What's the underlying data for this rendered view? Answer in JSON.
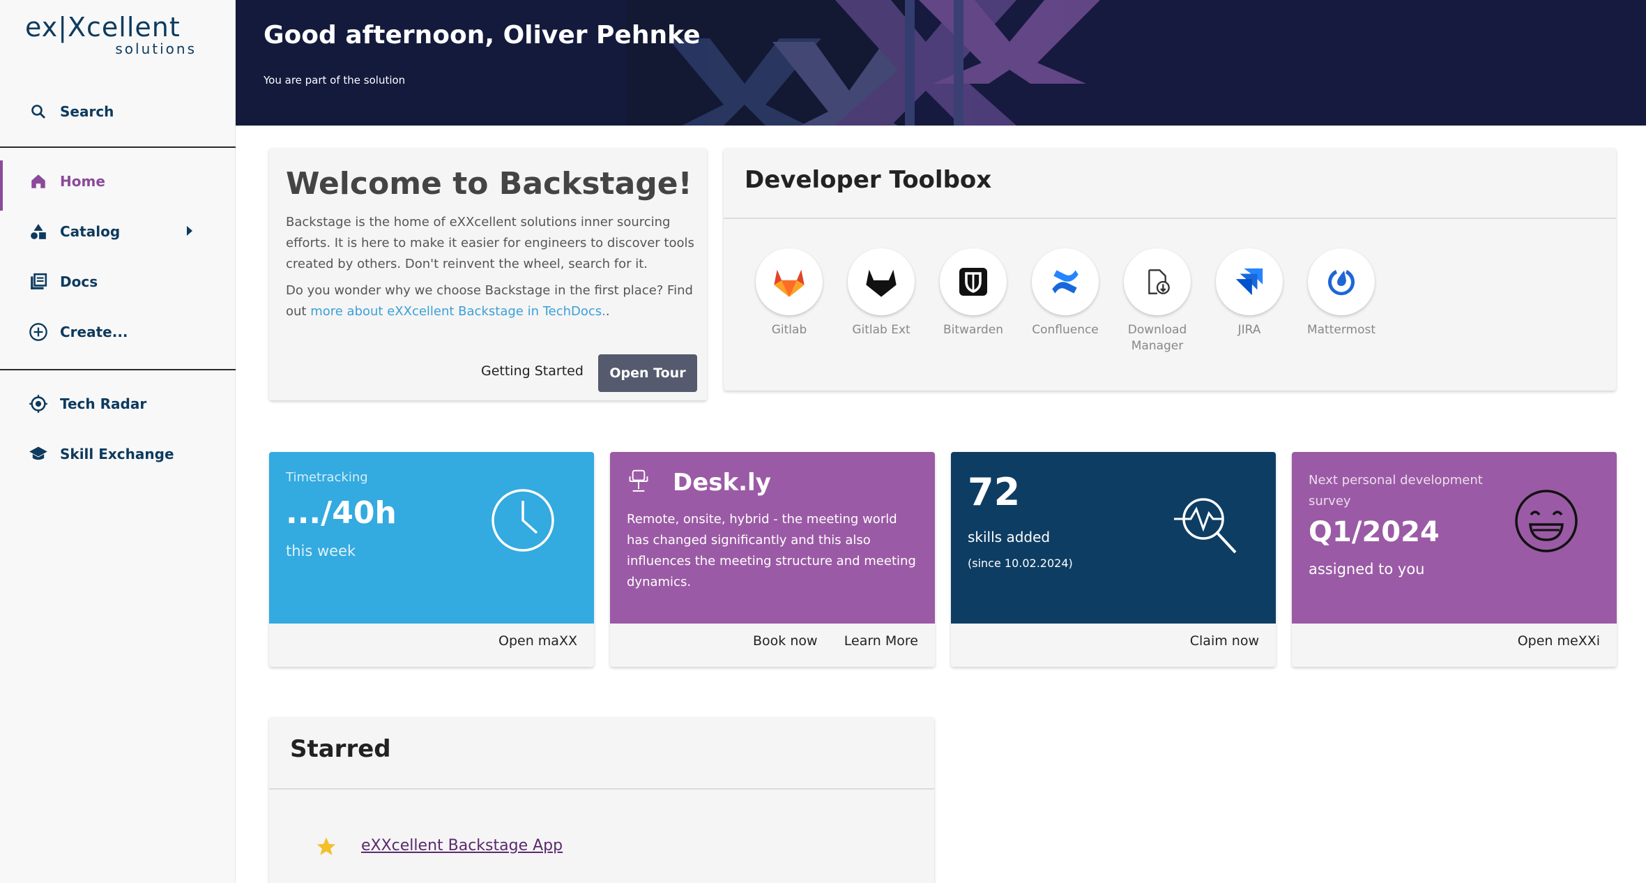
{
  "brand": {
    "logo_main": "ex|Xcellent",
    "logo_sub": "solutions"
  },
  "sidebar": {
    "items": [
      {
        "label": "Search",
        "icon": "search-icon"
      },
      {
        "label": "Home",
        "icon": "home-icon",
        "active": true
      },
      {
        "label": "Catalog",
        "icon": "catalog-icon"
      },
      {
        "label": "Docs",
        "icon": "docs-icon"
      },
      {
        "label": "Create...",
        "icon": "create-icon"
      },
      {
        "label": "Tech Radar",
        "icon": "radar-icon"
      },
      {
        "label": "Skill Exchange",
        "icon": "graduation-cap-icon"
      }
    ]
  },
  "header": {
    "greeting": "Good afternoon, Oliver Pehnke",
    "subtitle": "You are part of the solution"
  },
  "welcome": {
    "title": "Welcome to Backstage!",
    "para1": "Backstage is the home of eXXcellent solutions inner sourcing efforts. It is here to make it easier for engineers to discover tools created by others. Don't reinvent the wheel, search for it.",
    "para2_prefix": "Do you wonder why we choose Backstage in the first place? Find out ",
    "para2_link": "more about eXXcellent Backstage in TechDocs.",
    "para2_suffix": ".",
    "getting_started": "Getting Started",
    "open_tour": "Open Tour"
  },
  "toolbox": {
    "title": "Developer Toolbox",
    "tools": [
      {
        "line1": "Gitlab",
        "line2": "",
        "icon": "gitlab-icon"
      },
      {
        "line1": "Gitlab Ext",
        "line2": "",
        "icon": "gitlab-ext-icon"
      },
      {
        "line1": "Bitwarden",
        "line2": "",
        "icon": "bitwarden-icon"
      },
      {
        "line1": "Confluence",
        "line2": "",
        "icon": "confluence-icon"
      },
      {
        "line1": "Download",
        "line2": "Manager",
        "icon": "download-icon"
      },
      {
        "line1": "JIRA",
        "line2": "",
        "icon": "jira-icon"
      },
      {
        "line1": "Mattermost",
        "line2": "",
        "icon": "mattermost-icon"
      }
    ]
  },
  "tiles": {
    "timetracking": {
      "label": "Timetracking",
      "value": ".../40h",
      "caption": "this week",
      "action": "Open maXX",
      "color": "#33aae0"
    },
    "deskly": {
      "title": "Desk.ly",
      "text": "Remote, onsite, hybrid - the meeting world has changed significantly and this also influences the meeting structure and meeting dynamics.",
      "action1": "Book now",
      "action2": "Learn More",
      "color": "#9b5aa5"
    },
    "skills": {
      "value": "72",
      "caption": "skills added",
      "since": "(since 10.02.2024)",
      "action": "Claim now",
      "color": "#0e3d63"
    },
    "survey": {
      "label": "Next personal development survey",
      "value": "Q1/2024",
      "caption": "assigned to you",
      "action": "Open meXXi",
      "color": "#9b5aa5"
    }
  },
  "starred": {
    "title": "Starred",
    "items": [
      {
        "label": "eXXcellent Backstage App"
      }
    ]
  }
}
